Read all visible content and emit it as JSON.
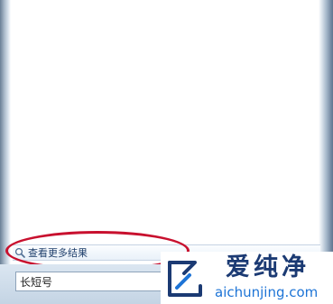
{
  "start_menu": {
    "more_results": {
      "label": "查看更多结果",
      "icon": "search-icon"
    },
    "search_box": {
      "value": "长短号"
    }
  },
  "annotation": {
    "shape": "ellipse",
    "color": "#c8102e"
  },
  "watermark": {
    "brand_cn": "爱纯净",
    "site": "aichunjing.com",
    "brand_color": "#1b3a73",
    "site_color": "#1d74d6"
  }
}
